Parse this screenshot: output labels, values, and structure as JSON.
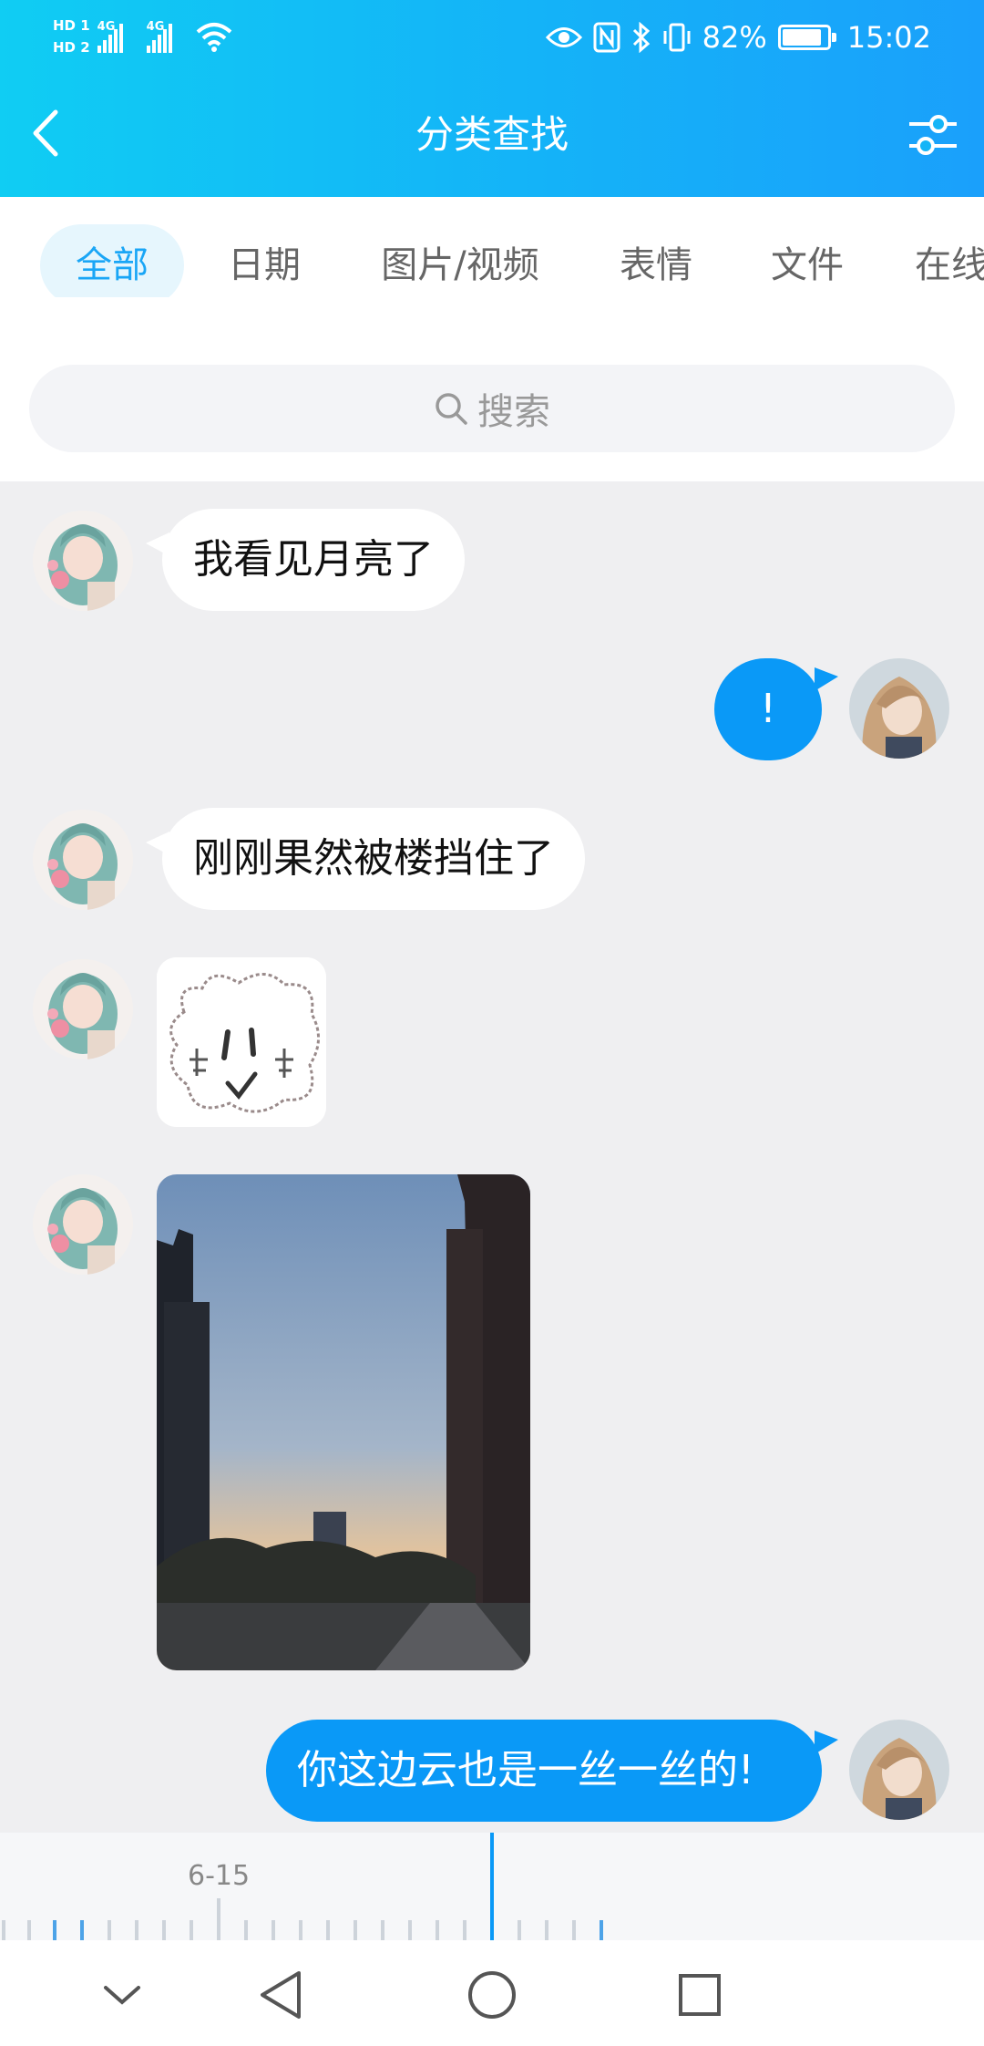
{
  "status_bar": {
    "sim1": "HD 1",
    "sim2": "HD 2",
    "network1": "4G",
    "network2": "4G",
    "battery_percent": "82%",
    "battery_level": 0.82,
    "time": "15:02",
    "icons": [
      "eye-icon",
      "nfc-icon",
      "bluetooth-icon",
      "vibrate-icon",
      "battery-icon"
    ]
  },
  "header": {
    "title": "分类查找",
    "back_icon": "chevron-left-icon",
    "filter_icon": "sliders-icon"
  },
  "tabs": [
    {
      "label": "全部",
      "active": true
    },
    {
      "label": "日期",
      "active": false
    },
    {
      "label": "图片/视频",
      "active": false
    },
    {
      "label": "表情",
      "active": false
    },
    {
      "label": "文件",
      "active": false
    },
    {
      "label": "在线",
      "active": false
    }
  ],
  "search": {
    "placeholder": "搜索",
    "icon": "search-icon"
  },
  "messages": [
    {
      "side": "left",
      "type": "text",
      "text": "我看见月亮了"
    },
    {
      "side": "right",
      "type": "text",
      "text": "!"
    },
    {
      "side": "left",
      "type": "text",
      "text": "刚刚果然被楼挡住了"
    },
    {
      "side": "left",
      "type": "sticker",
      "text": ""
    },
    {
      "side": "left",
      "type": "image",
      "text": ""
    },
    {
      "side": "right",
      "type": "text",
      "text": "你这边云也是一丝一丝的!"
    }
  ],
  "timeline": {
    "date_label": "6-15"
  },
  "nav_bar": {
    "icons": [
      "chevron-down-icon",
      "back-triangle-icon",
      "home-circle-icon",
      "recent-square-icon"
    ]
  },
  "colors": {
    "header_start": "#10cdf3",
    "header_end": "#1aa0fb",
    "accent": "#0a99f7",
    "chat_bg": "#efeff1"
  }
}
